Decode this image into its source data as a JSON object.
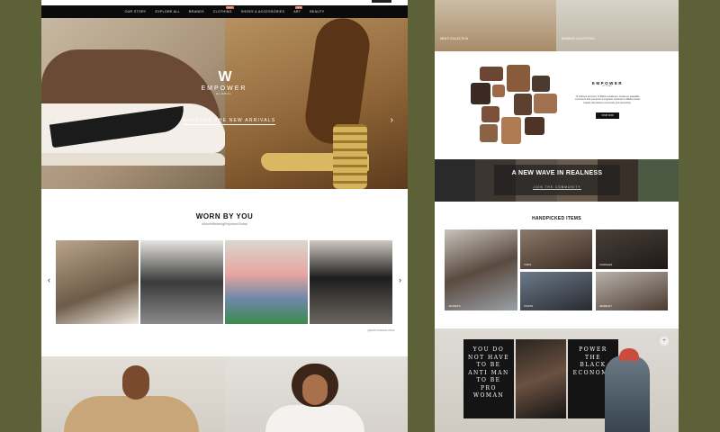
{
  "nav": {
    "items": [
      "OUR STORY",
      "EXPLORE ALL",
      "BRANDS",
      "CLOTHING",
      "SHOES & ACCESSORIES",
      "ART",
      "BEAUTY"
    ],
    "new_badge": "NEW"
  },
  "hero": {
    "brand": "EMPOWER",
    "brand_sub": "GLOBAL",
    "cta": "EXPLORE THE NEW ARRIVALS",
    "prev": "‹",
    "next": "›"
  },
  "worn_by_you": {
    "title": "WORN BY YOU",
    "hashtag": "#WorthWearingEmpowerGlobal",
    "prev": "‹",
    "next": "›",
    "instagram": "@EMPOWERGLOBAL"
  },
  "right": {
    "mens_label": "MEN'S COLLECTION",
    "womens_label": "WOMEN'S COLLECTION",
    "brand": {
      "word": "EMPOWER",
      "sub": "GLOBAL",
      "text": "To build an economy of Black excellence. Create an equitable commerce and economic ecosystem centered on Black-owned brands that fosters community and ownership.",
      "button": "SHOP NOW"
    },
    "wave": {
      "title": "A NEW WAVE IN REALNESS",
      "cta": "JOIN THE COMMUNITY"
    },
    "handpicked": {
      "title": "HANDPICKED ITEMS",
      "items": [
        "JACKETS",
        "TOPS",
        "CANDLES",
        "COATS",
        "JEWELRY"
      ]
    },
    "magazines": [
      "YOU DO NOT HAVE TO BE ANTI MAN TO BE PRO WOMAN",
      "",
      "POWER THE BLACK ECONOMY"
    ],
    "plus": "+"
  },
  "colors": {
    "background": "#5d6138",
    "nav": "#0b0b0b",
    "accent": "#d96a4b"
  }
}
